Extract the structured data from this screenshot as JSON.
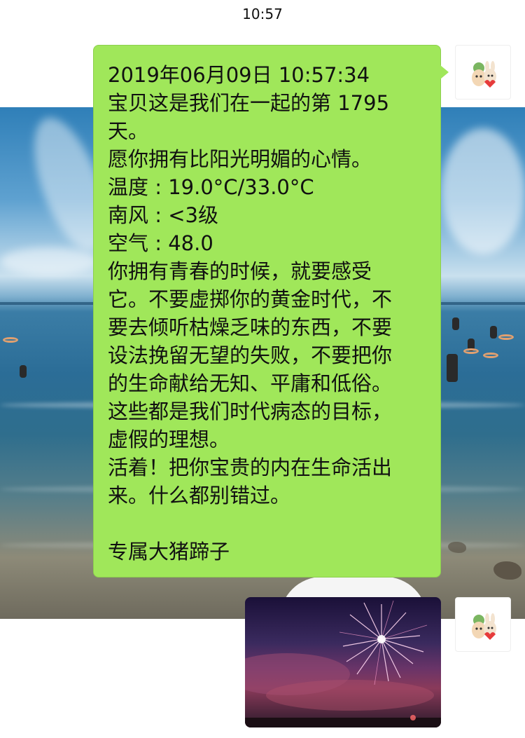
{
  "status_bar": {
    "time": "10:57"
  },
  "message": {
    "lines": [
      "2019年06月09日 10:57:34",
      "宝贝这是我们在一起的第 1795",
      "天。",
      "愿你拥有比阳光明媚的心情。",
      "温度 : 19.0°C/33.0°C",
      "南风 : <3级",
      "空气 : 48.0",
      "你拥有青春的时候，就要感受",
      "它。不要虚掷你的黄金时代，不",
      "要去倾听枯燥乏味的东西，不要",
      "设法挽留无望的失败，不要把你",
      "的生命献给无知、平庸和低俗。",
      "这些都是我们时代病态的目标，",
      "虚假的理想。",
      "活着！把你宝贵的内在生命活出",
      "来。什么都别错过。",
      "",
      "专属大猪蹄子"
    ]
  },
  "avatar": {
    "icon": "cartoon-avatar-icon"
  },
  "image_message": {
    "subject": "fireworks-photo"
  },
  "colors": {
    "bubble": "#a0e75a",
    "background": "#ffffff"
  }
}
